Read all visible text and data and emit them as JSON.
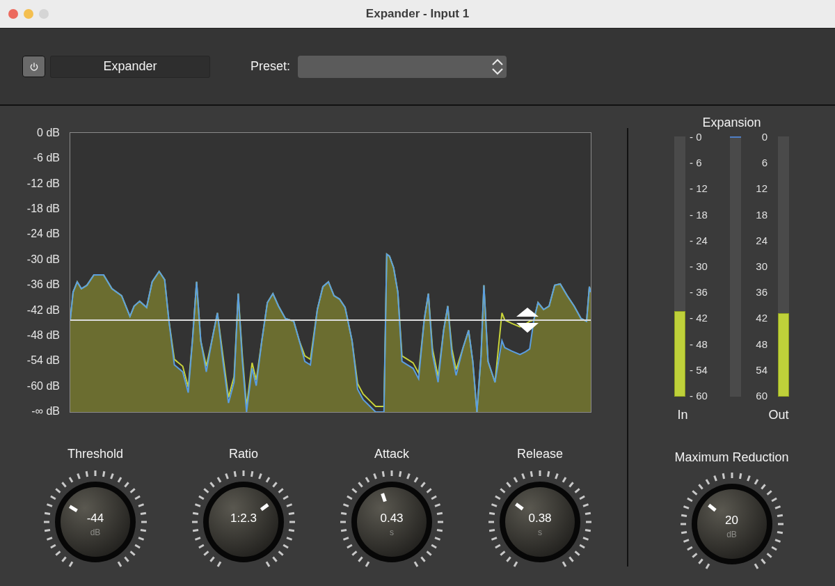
{
  "window": {
    "title": "Expander - Input 1"
  },
  "toolbar": {
    "plugin_name": "Expander",
    "preset_label": "Preset:"
  },
  "graph": {
    "scale_labels": [
      "0 dB",
      "-6 dB",
      "-12 dB",
      "-18 dB",
      "-24 dB",
      "-30 dB",
      "-36 dB",
      "-42 dB",
      "-48 dB",
      "-54 dB",
      "-60 dB",
      "-∞ dB"
    ]
  },
  "meters": {
    "title": "Expansion",
    "in": {
      "label": "In",
      "level": 0.33
    },
    "expansion": {
      "level": 0
    },
    "out": {
      "label": "Out",
      "level": 0.32
    },
    "in_scale": [
      "- 0",
      "- 6",
      "- 12",
      "- 18",
      "- 24",
      "- 30",
      "- 36",
      "- 42",
      "- 48",
      "- 54",
      "- 60"
    ],
    "out_scale": [
      "0",
      "6",
      "12",
      "18",
      "24",
      "30",
      "36",
      "42",
      "48",
      "54",
      "60"
    ]
  },
  "knobs": [
    {
      "label": "Threshold",
      "value": "-44",
      "unit": "dB",
      "level": 0.28
    },
    {
      "label": "Ratio",
      "value": "1:2.3",
      "level": 0.7
    },
    {
      "label": "Attack",
      "value": "0.43",
      "unit": "s",
      "level": 0.43
    },
    {
      "label": "Release",
      "value": "0.38",
      "unit": "s",
      "level": 0.3
    }
  ],
  "max_reduction": {
    "label": "Maximum Reduction",
    "value": "20",
    "unit": "dB",
    "level": 0.31
  }
}
